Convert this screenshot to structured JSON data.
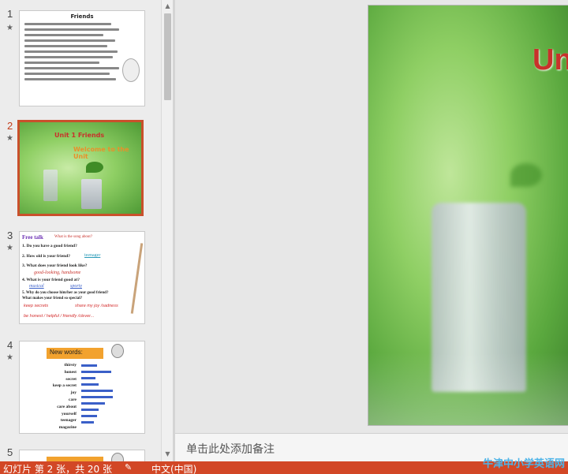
{
  "thumbnails": [
    {
      "number": "1",
      "star": "★",
      "title": "Friends"
    },
    {
      "number": "2",
      "star": "★",
      "title": "Unit 1 Friends",
      "subtitle": "Welcome to the Unit"
    },
    {
      "number": "3",
      "star": "★",
      "heading": "Free talk",
      "subheading": "What is the song about?",
      "lines": [
        "1. Do you have a good friend?",
        "2. How old is your friend?",
        "teenager",
        "3. What does your friend look like?",
        "good-looking, handsome",
        "4. What is your friend good at?",
        "musical",
        "sporty",
        "5. Why do you choose him/her as your good friend?",
        "What makes your friend so special?",
        "keep secrets",
        "share my joy /sadness",
        "be honest / helpful / friendly /clever..."
      ]
    },
    {
      "number": "4",
      "star": "★",
      "heading": "New words:",
      "words": [
        "thirsty",
        "honest",
        "secret",
        "keep a secret",
        "joy",
        "care",
        "care about",
        "yourself",
        "teenager",
        "magazine"
      ]
    },
    {
      "number": "5"
    }
  ],
  "slide": {
    "title": "Uni"
  },
  "notes": {
    "placeholder": "单击此处添加备注"
  },
  "status": {
    "slide_info": "幻灯片 第 2 张，共 20 张",
    "language": "中文(中国)",
    "watermark": "牛津中小学英语网"
  },
  "colors": {
    "accent": "#d24726",
    "title_red": "#c8312b"
  }
}
